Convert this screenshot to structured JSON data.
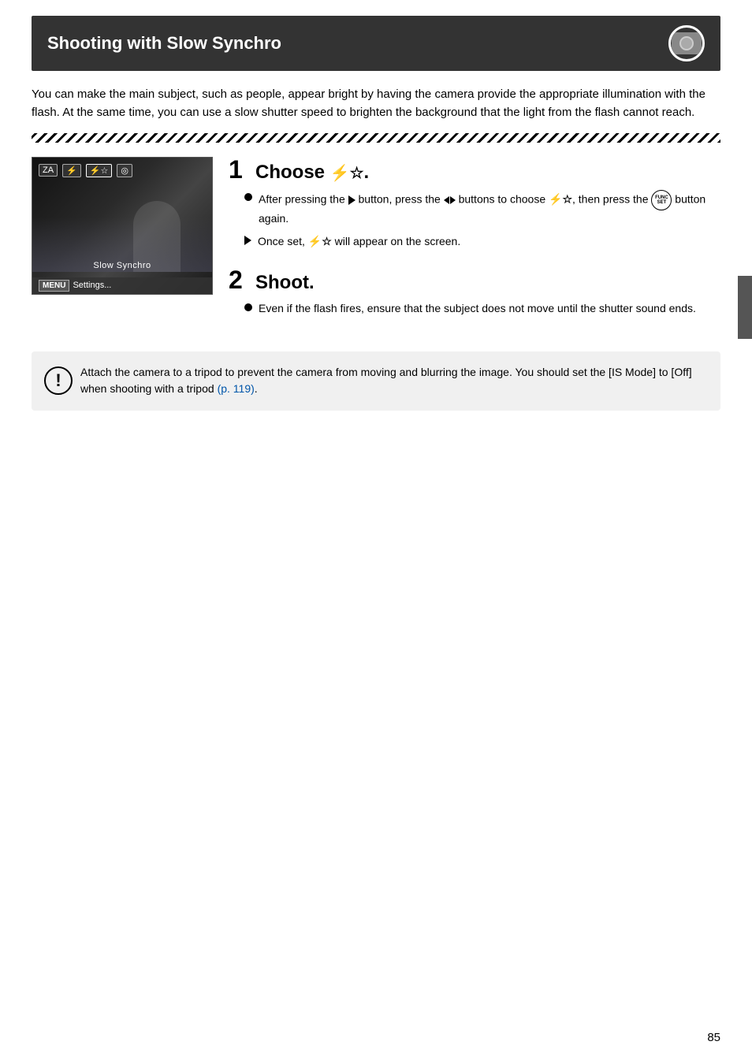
{
  "page": {
    "title": "Shooting with Slow Synchro",
    "page_number": "85"
  },
  "intro": {
    "text": "You can make the main subject, such as people, appear bright by having the camera provide the appropriate illumination with the flash. At the same time, you can use a slow shutter speed to brighten the background that the light from the flash cannot reach."
  },
  "camera_display": {
    "icons": [
      "ZA",
      "⚡",
      "⚡☆",
      "◎"
    ],
    "label": "Slow Synchro",
    "menu_text": "Settings..."
  },
  "steps": [
    {
      "number": "1",
      "title": "Choose",
      "icon_label": "⚡☆",
      "bullets": [
        {
          "type": "circle",
          "text_parts": [
            "After pressing the",
            " ▶ ",
            "button, press the",
            " ◀▶ ",
            "buttons to choose",
            " ⚡☆ ",
            ", then press the",
            " FUNC/SET ",
            "button again."
          ]
        },
        {
          "type": "arrow",
          "text": "Once set, ⚡☆ will appear on the screen."
        }
      ]
    },
    {
      "number": "2",
      "title": "Shoot.",
      "bullets": [
        {
          "type": "circle",
          "text": "Even if the flash fires, ensure that the subject does not move until the shutter sound ends."
        }
      ]
    }
  ],
  "note": {
    "text_before_link": "Attach the camera to a tripod to prevent the camera from moving and blurring the image. You should set the [IS Mode] to [Off] when shooting with a tripod ",
    "link_text": "(p. 119)",
    "text_after_link": "."
  },
  "labels": {
    "func_set_top": "FUNC",
    "func_set_bottom": "SET",
    "once_set_text": "Once set,",
    "once_set_icon": "⚡☆",
    "once_set_suffix": "will appear on the screen."
  }
}
